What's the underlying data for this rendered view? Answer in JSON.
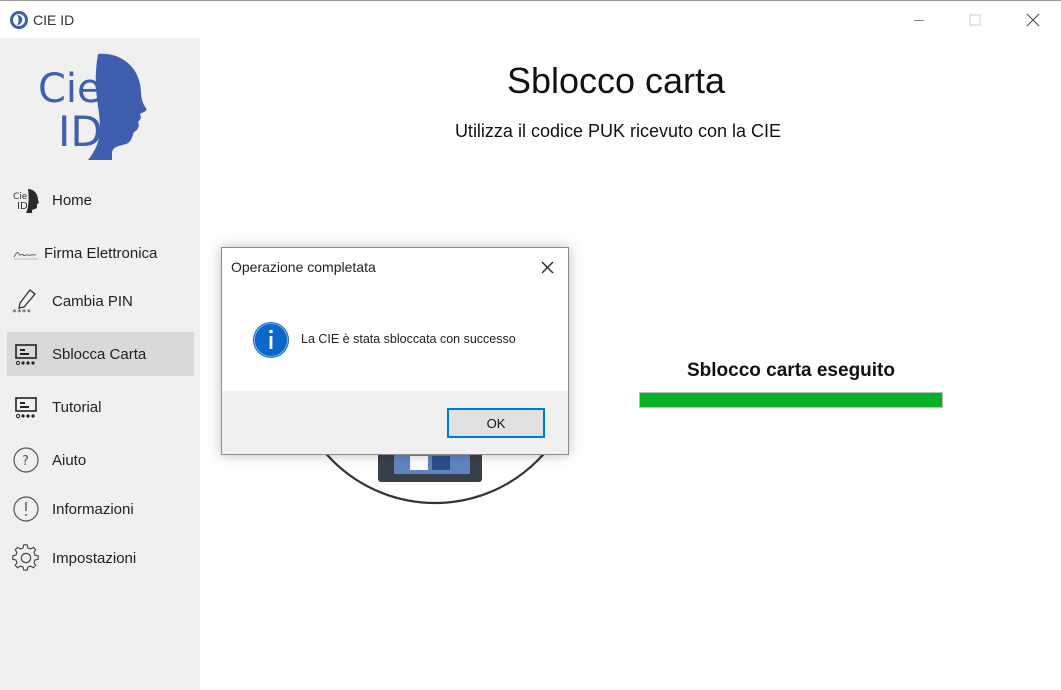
{
  "window": {
    "title": "CIE ID",
    "icon": "cie-id-app-icon",
    "controls": [
      "minimize-icon",
      "maximize-icon",
      "close-icon"
    ]
  },
  "sidebar": {
    "logo": "cie-id-logo",
    "logo_text": "Cie ID",
    "items": [
      {
        "label": "Home",
        "icon": "cie-id-icon",
        "active": false
      },
      {
        "label": "Firma Elettronica",
        "icon": "signature-icon",
        "active": false
      },
      {
        "label": "Cambia PIN",
        "icon": "pen-pin-icon",
        "active": false
      },
      {
        "label": "Sblocca Carta",
        "icon": "card-reader-icon",
        "active": true
      },
      {
        "label": "Tutorial",
        "icon": "card-reader-icon",
        "active": false
      },
      {
        "label": "Aiuto",
        "icon": "question-icon",
        "active": false
      },
      {
        "label": "Informazioni",
        "icon": "info-exclamation-icon",
        "active": false
      },
      {
        "label": "Impostazioni",
        "icon": "gear-icon",
        "active": false
      }
    ]
  },
  "main": {
    "title": "Sblocco carta",
    "subtitle": "Utilizza il codice PUK ricevuto con la CIE",
    "status": "Sblocco carta eseguito",
    "progress": 1.0,
    "progress_color": "#06b025"
  },
  "dialog": {
    "title": "Operazione completata",
    "message": "La CIE è stata sbloccata con successo",
    "ok_label": "OK",
    "icon": "info-icon",
    "accent": "#0078d7"
  },
  "colors": {
    "brand_blue": "#3f5fae",
    "sidebar_bg": "#f0f0f0",
    "active_bg": "#d9d9d9"
  }
}
